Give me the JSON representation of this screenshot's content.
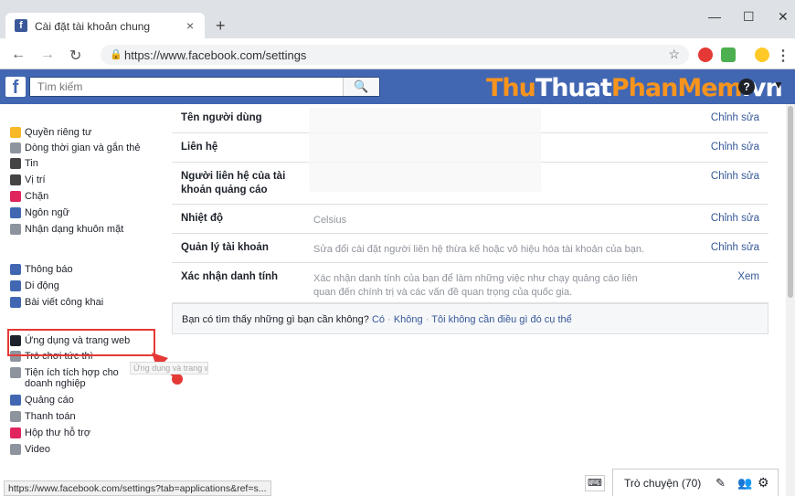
{
  "browser": {
    "tab_title": "Cài đặt tài khoản chung",
    "tab_close": "×",
    "new_tab": "+",
    "url": "https://www.facebook.com/settings",
    "win_min": "—",
    "win_max": "☐",
    "win_close": "✕"
  },
  "fb": {
    "logo": "f",
    "search_placeholder": "Tìm kiếm",
    "watermark_a": "Thu",
    "watermark_b": "Thuat",
    "watermark_c": "PhanMem",
    "watermark_d": ".vn"
  },
  "sidebar": {
    "items": [
      {
        "label": "Quyền riêng tư",
        "icon": "lock-icon",
        "color": "#f7b928"
      },
      {
        "label": "Dòng thời gian và gắn thẻ",
        "icon": "timeline-icon",
        "color": "#8d949e"
      },
      {
        "label": "Tin",
        "icon": "book-icon",
        "color": "#444"
      },
      {
        "label": "Vị trí",
        "icon": "location-icon",
        "color": "#444"
      },
      {
        "label": "Chặn",
        "icon": "block-icon",
        "color": "#e0245e"
      },
      {
        "label": "Ngôn ngữ",
        "icon": "language-icon",
        "color": "#4267b2"
      },
      {
        "label": "Nhận dạng khuôn mặt",
        "icon": "face-icon",
        "color": "#8d949e"
      },
      {
        "label": "Thông báo",
        "icon": "globe-icon",
        "color": "#4267b2"
      },
      {
        "label": "Di động",
        "icon": "mobile-icon",
        "color": "#4267b2"
      },
      {
        "label": "Bài viết công khai",
        "icon": "rss-icon",
        "color": "#4267b2"
      },
      {
        "label": "Ứng dụng và trang web",
        "icon": "apps-icon",
        "color": "#1d2129"
      },
      {
        "label": "Trò chơi tức thì",
        "icon": "game-icon",
        "color": "#8d949e"
      },
      {
        "label": "Tiện ích tích hợp cho doanh nghiệp",
        "icon": "business-icon",
        "color": "#8d949e"
      },
      {
        "label": "Quảng cáo",
        "icon": "ads-icon",
        "color": "#4267b2"
      },
      {
        "label": "Thanh toán",
        "icon": "payment-icon",
        "color": "#8d949e"
      },
      {
        "label": "Hộp thư hỗ trợ",
        "icon": "support-icon",
        "color": "#e0245e"
      },
      {
        "label": "Video",
        "icon": "video-icon",
        "color": "#8d949e"
      }
    ],
    "tooltip": "Ứng dụng và trang web"
  },
  "settings": {
    "rows": [
      {
        "key": "Tên người dùng",
        "value": "",
        "action": "Chỉnh sửa"
      },
      {
        "key": "Liên hệ",
        "value": "",
        "action": "Chỉnh sửa"
      },
      {
        "key": "Người liên hệ của tài khoản quảng cáo",
        "value": "",
        "action": "Chỉnh sửa"
      },
      {
        "key": "Nhiệt độ",
        "value": "Celsius",
        "action": "Chỉnh sửa"
      },
      {
        "key": "Quản lý tài khoản",
        "value": "Sửa đổi cài đặt người liên hệ thừa kế hoặc vô hiệu hóa tài khoản của bạn.",
        "action": "Chỉnh sửa"
      },
      {
        "key": "Xác nhận danh tính",
        "value": "Xác nhận danh tính của bạn để làm những việc như chạy quảng cáo liên quan đến chính trị và các vấn đề quan trọng của quốc gia.",
        "action": "Xem"
      }
    ],
    "hint_question": "Bạn có tìm thấy những gì bạn cần không?",
    "hint_yes": "Có",
    "hint_no": "Không",
    "hint_dont_care": "Tôi không cần điều gì đó cụ thể",
    "hint_sep": "·"
  },
  "status_url": "https://www.facebook.com/settings?tab=applications&ref=s...",
  "chat_label": "Trò chuyện (70)"
}
